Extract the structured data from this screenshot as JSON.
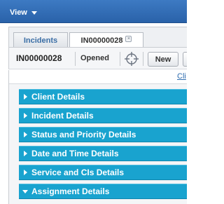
{
  "menubar": {
    "view_label": "View"
  },
  "tabs": [
    {
      "label": "Incidents"
    },
    {
      "label": "IN00000028",
      "close_icon": "close-icon",
      "close_glyph": "×"
    }
  ],
  "record": {
    "id": "IN00000028",
    "status": "Opened",
    "target_icon": "crosshair-icon",
    "new_label": "New"
  },
  "link_row": {
    "partial_link_text": "Cli"
  },
  "sections": [
    {
      "label": "Client Details",
      "expanded": false
    },
    {
      "label": "Incident Details",
      "expanded": false
    },
    {
      "label": "Status and Priority Details",
      "expanded": false
    },
    {
      "label": "Date and Time Details",
      "expanded": false
    },
    {
      "label": "Service and CIs Details",
      "expanded": false
    },
    {
      "label": "Assignment Details",
      "expanded": true
    }
  ],
  "colors": {
    "menubar": "#2f6db0",
    "section_header": "#19a3cf",
    "tab_text_inactive": "#3a6ea5"
  }
}
